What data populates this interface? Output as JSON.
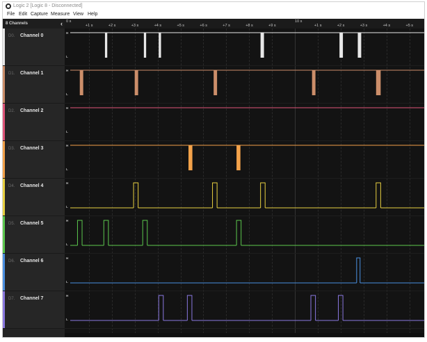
{
  "window": {
    "title": "Logic 2 [Logic 8 - Disconnected]"
  },
  "menu": [
    "File",
    "Edit",
    "Capture",
    "Measure",
    "View",
    "Help"
  ],
  "sidebar": {
    "header": "8 Channels",
    "collapse_icon": "chevron-left-icon"
  },
  "timeline": {
    "labels": [
      {
        "t": 0,
        "text": "0 s",
        "major": true
      },
      {
        "t": 1,
        "text": "+1 s"
      },
      {
        "t": 2,
        "text": "+2 s"
      },
      {
        "t": 3,
        "text": "+3 s"
      },
      {
        "t": 4,
        "text": "+4 s"
      },
      {
        "t": 5,
        "text": "+5 s"
      },
      {
        "t": 6,
        "text": "+6 s"
      },
      {
        "t": 7,
        "text": "+7 s"
      },
      {
        "t": 8,
        "text": "+8 s"
      },
      {
        "t": 9,
        "text": "+9 s"
      },
      {
        "t": 10,
        "text": "10 s",
        "major": true
      },
      {
        "t": 11,
        "text": "+1 s"
      },
      {
        "t": 12,
        "text": "+2 s"
      },
      {
        "t": 13,
        "text": "+3 s"
      },
      {
        "t": 14,
        "text": "+4 s"
      },
      {
        "t": 15,
        "text": "+5 s"
      }
    ]
  },
  "channels": [
    {
      "index": "D0.",
      "name": "Channel 0",
      "color": "#e8e8e8",
      "default": "high",
      "pulses": [
        [
          1.7,
          1.8
        ],
        [
          3.4,
          3.5
        ],
        [
          4.05,
          4.15
        ],
        [
          8.5,
          8.65
        ],
        [
          11.95,
          12.1
        ],
        [
          12.75,
          12.9
        ]
      ]
    },
    {
      "index": "D1.",
      "name": "Channel 1",
      "color": "#cc8e6a",
      "default": "high",
      "pulses": [
        [
          0.6,
          0.75
        ],
        [
          3.0,
          3.15
        ],
        [
          6.45,
          6.6
        ],
        [
          10.75,
          10.9
        ],
        [
          13.55,
          13.75
        ]
      ]
    },
    {
      "index": "D2.",
      "name": "Channel 2",
      "color": "#e0557a",
      "default": "high",
      "pulses": []
    },
    {
      "index": "D3.",
      "name": "Channel 3",
      "color": "#f4a24a",
      "default": "high",
      "pulses": [
        [
          5.35,
          5.52
        ],
        [
          7.45,
          7.62
        ]
      ]
    },
    {
      "index": "D4.",
      "name": "Channel 4",
      "color": "#e8d040",
      "default": "low",
      "pulses": [
        [
          2.95,
          3.15
        ],
        [
          6.4,
          6.6
        ],
        [
          8.5,
          8.7
        ],
        [
          13.55,
          13.75
        ]
      ]
    },
    {
      "index": "D5.",
      "name": "Channel 5",
      "color": "#5cc84e",
      "default": "low",
      "pulses": [
        [
          0.5,
          0.7
        ],
        [
          1.65,
          1.85
        ],
        [
          3.35,
          3.55
        ],
        [
          7.45,
          7.65
        ]
      ]
    },
    {
      "index": "D6.",
      "name": "Channel 6",
      "color": "#4a90e2",
      "default": "low",
      "pulses": [
        [
          12.7,
          12.85
        ]
      ]
    },
    {
      "index": "D7.",
      "name": "Channel 7",
      "color": "#8a78e0",
      "default": "low",
      "pulses": [
        [
          4.05,
          4.25
        ],
        [
          5.3,
          5.5
        ],
        [
          10.7,
          10.9
        ],
        [
          11.9,
          12.1
        ]
      ]
    }
  ]
}
